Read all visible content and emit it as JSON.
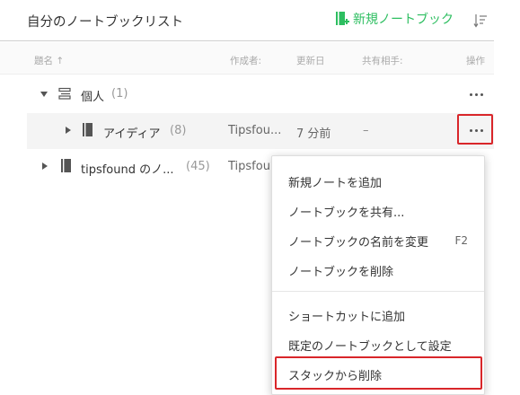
{
  "header": {
    "title": "自分のノートブックリスト",
    "new_notebook_label": "新規ノートブック",
    "accent_color": "#2dbe60"
  },
  "columns": {
    "title": "題名 ↑",
    "author": "作成者:",
    "updated": "更新日",
    "shared_with": "共有相手:",
    "actions": "操作"
  },
  "rows": [
    {
      "name": "個人",
      "count": "(1)",
      "type": "stack",
      "expanded": true
    },
    {
      "name": "アイディア",
      "count": "(8)",
      "author": "Tipsfou...",
      "updated": "7 分前",
      "shared": "–",
      "type": "notebook",
      "selected": true
    },
    {
      "name": "tipsfound のノ...",
      "count": "(45)",
      "author": "Tipsfou",
      "type": "notebook"
    }
  ],
  "context_menu": {
    "items": [
      {
        "label": "新規ノートを追加"
      },
      {
        "label": "ノートブックを共有..."
      },
      {
        "label": "ノートブックの名前を変更",
        "shortcut": "F2"
      },
      {
        "label": "ノートブックを削除"
      },
      {
        "label": "ショートカットに追加"
      },
      {
        "label": "既定のノートブックとして設定"
      },
      {
        "label": "スタックから削除"
      }
    ]
  },
  "highlight_color": "#d9262a",
  "icons": {
    "new_notebook": "notebook-plus-icon",
    "sort": "sort-icon",
    "stack": "stack-icon",
    "notebook": "notebook-icon",
    "more": "more-dots-icon"
  }
}
